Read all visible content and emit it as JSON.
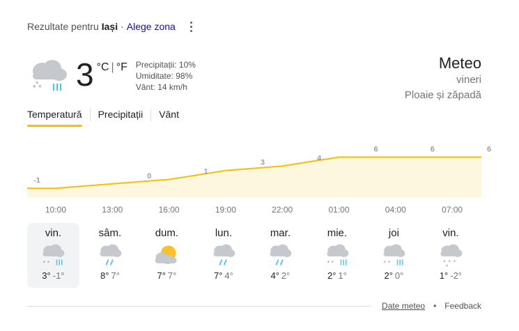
{
  "header": {
    "prefix": "Rezultate pentru",
    "location": "Iași",
    "separator": "·",
    "change_zone": "Alege zona",
    "menu_icon": "more-vert-icon"
  },
  "current": {
    "icon": "cloud-rain-snow-icon",
    "temperature": "3",
    "unit_c": "°C",
    "unit_sep": "|",
    "unit_f": "°F",
    "precipitation": "Precipitații: 10%",
    "humidity": "Umiditate: 98%",
    "wind": "Vânt: 14 km/h"
  },
  "summary": {
    "title": "Meteo",
    "day": "vineri",
    "condition": "Ploaie și zăpadă"
  },
  "tabs": [
    {
      "label": "Temperatură",
      "active": true
    },
    {
      "label": "Precipitații",
      "active": false
    },
    {
      "label": "Vânt",
      "active": false
    }
  ],
  "chart_data": {
    "type": "area",
    "x": [
      "10:00",
      "13:00",
      "16:00",
      "19:00",
      "22:00",
      "01:00",
      "04:00",
      "07:00"
    ],
    "labels": [
      "-1",
      "0",
      "1",
      "3",
      "4",
      "6",
      "6",
      "6"
    ],
    "values": [
      -1,
      0,
      1,
      3,
      4,
      6,
      6,
      6
    ],
    "ylim": [
      -3,
      10
    ],
    "fill_color": "#fef7e0",
    "line_color": "#fbbc04"
  },
  "days": [
    {
      "name": "vin.",
      "icon": "cloud-rain-snow-icon",
      "high": "3°",
      "low": "-1°",
      "selected": true
    },
    {
      "name": "sâm.",
      "icon": "cloud-snow-icon",
      "high": "8°",
      "low": "7°",
      "selected": false
    },
    {
      "name": "dum.",
      "icon": "partly-cloudy-icon",
      "high": "7°",
      "low": "7°",
      "selected": false
    },
    {
      "name": "lun.",
      "icon": "cloud-snow-icon",
      "high": "7°",
      "low": "4°",
      "selected": false
    },
    {
      "name": "mar.",
      "icon": "cloud-snow-icon",
      "high": "4°",
      "low": "2°",
      "selected": false
    },
    {
      "name": "mie.",
      "icon": "cloud-rain-snow-icon",
      "high": "2°",
      "low": "1°",
      "selected": false
    },
    {
      "name": "joi",
      "icon": "cloud-rain-snow-icon",
      "high": "2°",
      "low": "0°",
      "selected": false
    },
    {
      "name": "vin.",
      "icon": "cloud-snow-flakes-icon",
      "high": "1°",
      "low": "-2°",
      "selected": false
    }
  ],
  "footer": {
    "source_link": "Date meteo",
    "bullet": "•",
    "feedback": "Feedback"
  }
}
